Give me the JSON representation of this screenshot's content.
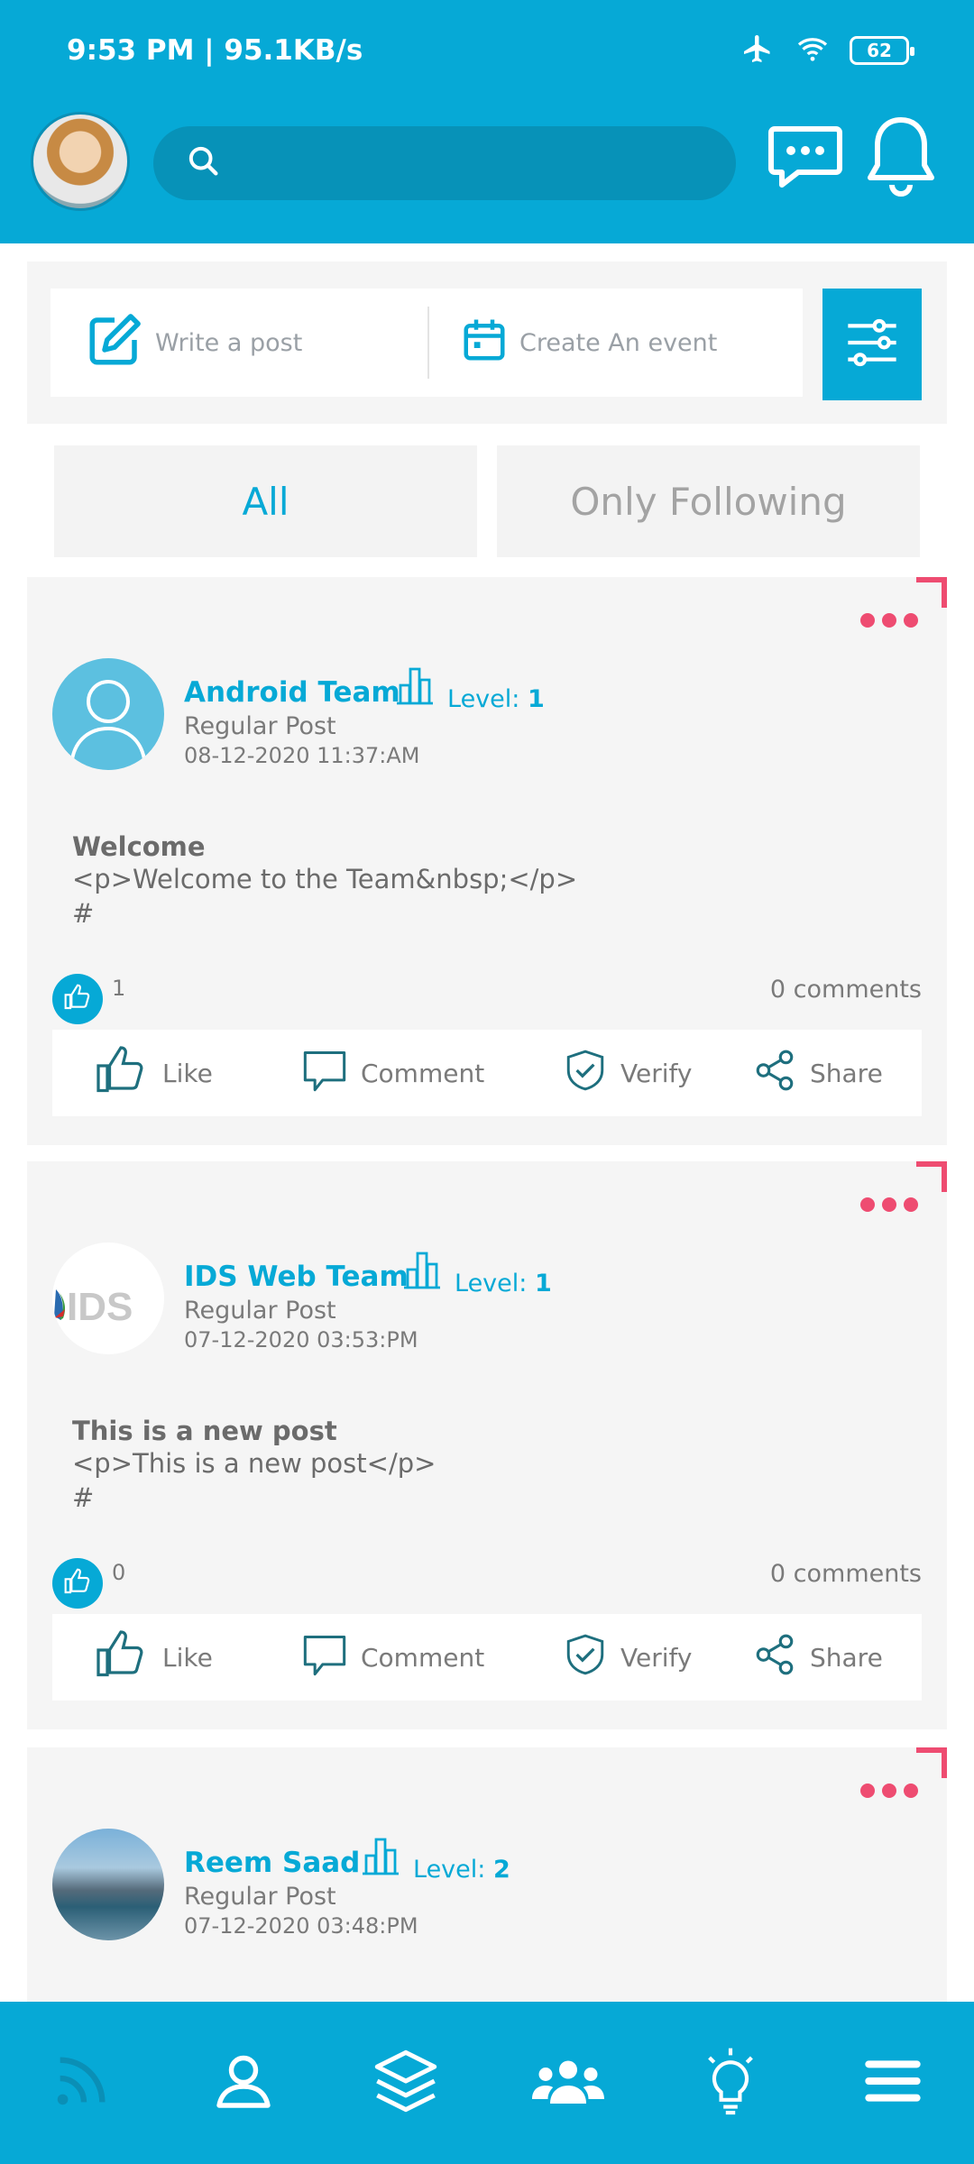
{
  "status": {
    "time": "9:53 PM | 95.1KB/s",
    "battery": "62"
  },
  "header": {
    "search_placeholder": ""
  },
  "composer": {
    "write_post": "Write a post",
    "create_event": "Create An event"
  },
  "tabs": [
    {
      "label": "All",
      "active": true
    },
    {
      "label": "Only Following",
      "active": false
    }
  ],
  "posts": [
    {
      "author": "Android Team",
      "level_label": "Level:",
      "level_value": "1",
      "type": "Regular Post",
      "date": "08-12-2020 11:37:AM",
      "title": "Welcome",
      "body": "<p>Welcome to the Team&nbsp;</p>",
      "hash": "#",
      "likes": "1",
      "comments": "0 comments"
    },
    {
      "author": "IDS Web Team",
      "level_label": "Level:",
      "level_value": "1",
      "type": "Regular Post",
      "date": "07-12-2020 03:53:PM",
      "title": "This is a new post",
      "body": "<p>This is a new post</p>",
      "hash": "#",
      "likes": "0",
      "comments": "0 comments",
      "logo_text": "IDS"
    },
    {
      "author": "Reem Saad",
      "level_label": "Level:",
      "level_value": "2",
      "type": "Regular Post",
      "date": "07-12-2020 03:48:PM"
    }
  ],
  "actions": {
    "like": "Like",
    "comment": "Comment",
    "verify": "Verify",
    "share": "Share"
  },
  "colors": {
    "primary": "#06a9d6",
    "accent": "#ee4c71"
  }
}
